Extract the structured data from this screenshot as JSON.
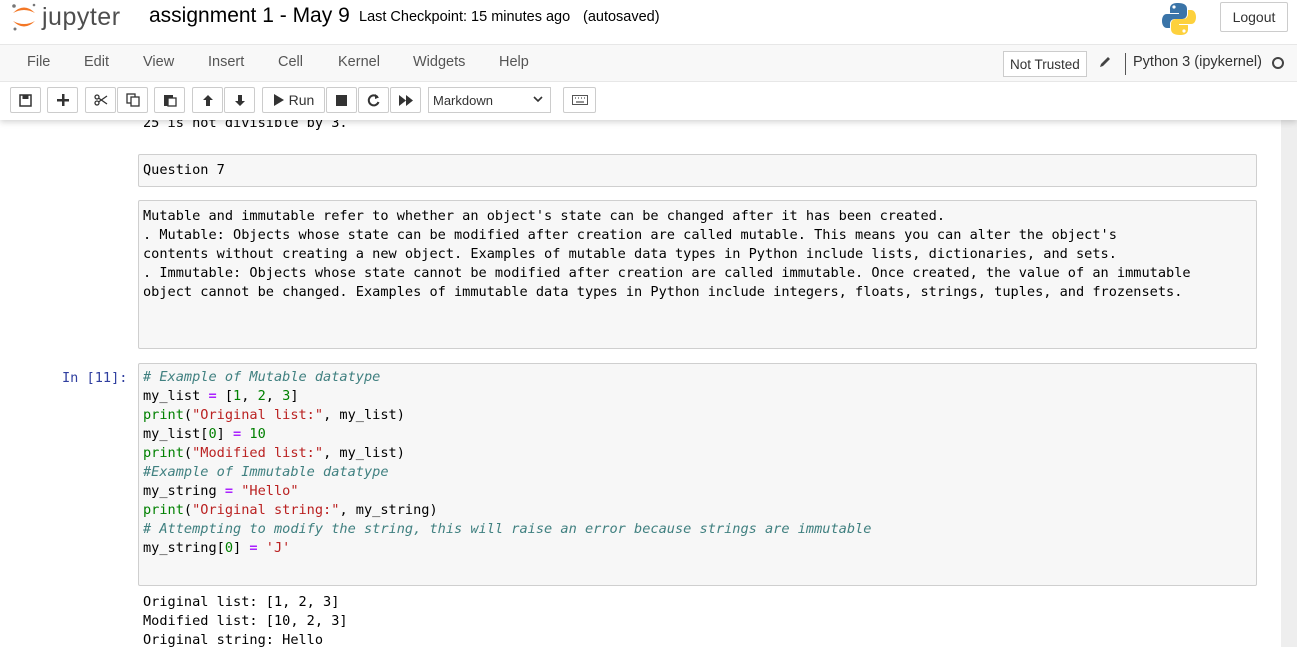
{
  "header": {
    "logo_text": "jupyter",
    "notebook_name": "assignment 1 - May 9",
    "checkpoint": "Last Checkpoint: 15 minutes ago",
    "autosave": "(autosaved)",
    "logout_label": "Logout"
  },
  "menu": {
    "items": [
      "File",
      "Edit",
      "View",
      "Insert",
      "Cell",
      "Kernel",
      "Widgets",
      "Help"
    ],
    "trust_label": "Not Trusted",
    "kernel_name": "Python 3 (ipykernel)"
  },
  "toolbar": {
    "run_label": "Run",
    "cell_type": "Markdown",
    "icons": [
      "save-icon",
      "plus-icon",
      "cut-icon",
      "copy-icon",
      "paste-icon",
      "arrow-up-icon",
      "arrow-down-icon",
      "play-icon",
      "stop-icon",
      "restart-icon",
      "fast-forward-icon",
      "keyboard-icon"
    ]
  },
  "cells": {
    "prev_output": "25 is not divisible by 3.",
    "md_question": "Question 7",
    "md_body": [
      "Mutable and immutable refer to whether an object's state can be changed after it has been created.",
      "",
      ". Mutable: Objects whose state can be modified after creation are called mutable. This means you can alter the object's",
      "contents without creating a new object. Examples of mutable data types in Python include lists, dictionaries, and sets.",
      "",
      ". Immutable: Objects whose state cannot be modified after creation are called immutable. Once created, the value of an immutable",
      "object cannot be changed. Examples of immutable data types in Python include integers, floats, strings, tuples, and frozensets."
    ],
    "code_prompt": "In [11]:",
    "code_lines": [
      "# Example of Mutable datatype",
      "my_list = [1, 2, 3]",
      "print(\"Original list:\", my_list)",
      "my_list[0] = 10",
      "print(\"Modified list:\", my_list)",
      "",
      "#Example of Immutable datatype",
      "my_string = \"Hello\"",
      "print(\"Original string:\", my_string)",
      "# Attempting to modify the string, this will raise an error because strings are immutable",
      "my_string[0] = 'J'"
    ],
    "output_lines": [
      "Original list: [1, 2, 3]",
      "Modified list: [10, 2, 3]",
      "Original string: Hello"
    ]
  }
}
